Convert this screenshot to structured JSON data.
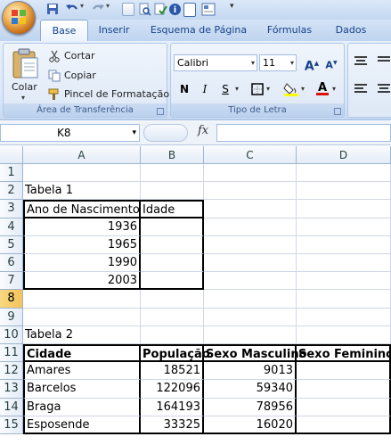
{
  "ribbon": {
    "tabs": [
      "Base",
      "Inserir",
      "Esquema de Página",
      "Fórmulas",
      "Dados"
    ],
    "clipboard": {
      "paste_label": "Colar",
      "cut_label": "Cortar",
      "copy_label": "Copiar",
      "format_painter_label": "Pincel de Formatação",
      "group_label": "Área de Transferência"
    },
    "font": {
      "font_name": "Calibri",
      "font_size": "11",
      "group_label": "Tipo de Letra",
      "bold_label": "N",
      "italic_label": "I",
      "underline_label": "S",
      "grow_label": "A",
      "shrink_label": "A",
      "font_color_label": "A"
    }
  },
  "formula_bar": {
    "name_box": "K8",
    "fx_label": "fx",
    "content": ""
  },
  "sheet": {
    "columns": [
      "A",
      "B",
      "C",
      "D"
    ],
    "rows": [
      "1",
      "2",
      "3",
      "4",
      "5",
      "6",
      "7",
      "8",
      "9",
      "10",
      "11",
      "12",
      "13",
      "14",
      "15"
    ],
    "cells": {
      "A2": "Tabela 1",
      "A3": "Ano de Nascimento",
      "B3": "Idade",
      "A4": "1936",
      "A5": "1965",
      "A6": "1990",
      "A7": "2003",
      "A10": "Tabela 2",
      "A11": "Cidade",
      "B11": "População",
      "C11": "Sexo Masculino",
      "D11": "Sexo Feminino",
      "A12": "Amares",
      "B12": "18521",
      "C12": "9013",
      "A13": "Barcelos",
      "B13": "122096",
      "C13": "59340",
      "A14": "Braga",
      "B14": "164193",
      "C14": "78956",
      "A15": "Esposende",
      "B15": "33325",
      "C15": "16020"
    }
  },
  "colors": {
    "accent": "#15428b",
    "header_bg": "#e4ecf7",
    "gridline": "#d0d7e5"
  }
}
